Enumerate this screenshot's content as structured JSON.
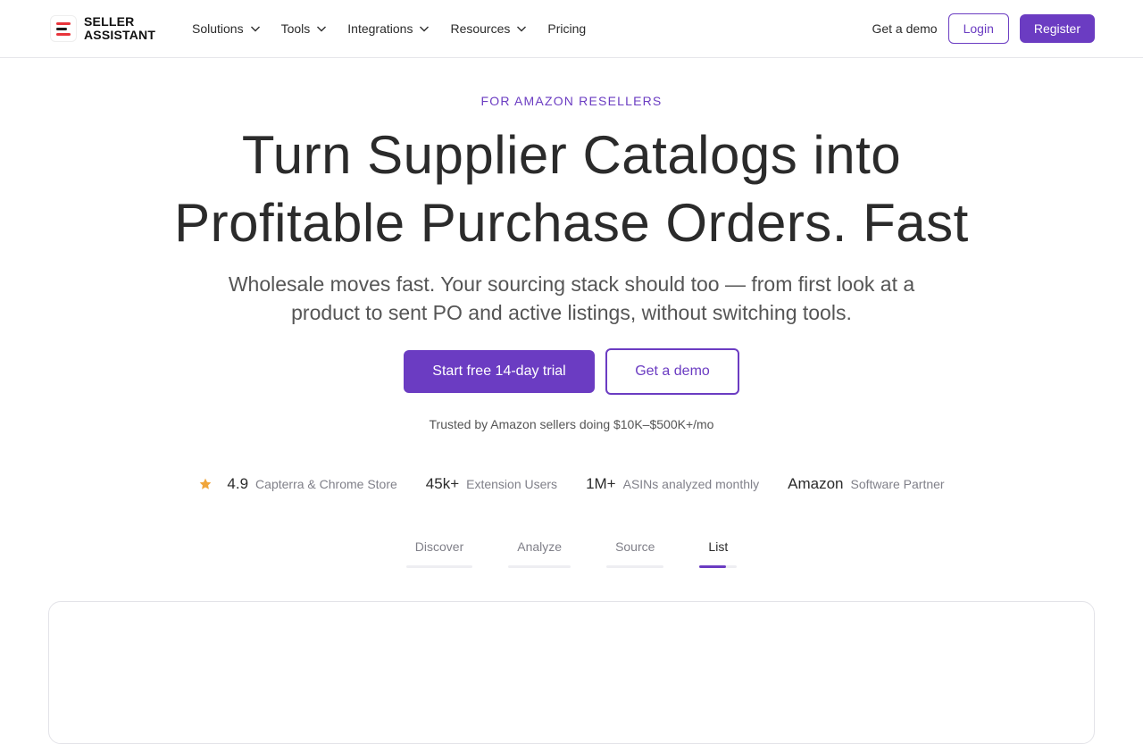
{
  "header": {
    "logo_line1": "SELLER",
    "logo_line2": "ASSISTANT",
    "nav": [
      {
        "label": "Solutions",
        "has_dropdown": true
      },
      {
        "label": "Tools",
        "has_dropdown": true
      },
      {
        "label": "Integrations",
        "has_dropdown": true
      },
      {
        "label": "Resources",
        "has_dropdown": true
      },
      {
        "label": "Pricing",
        "has_dropdown": false
      }
    ],
    "get_demo_label": "Get a demo",
    "login_label": "Login",
    "register_label": "Register"
  },
  "hero": {
    "eyebrow": "FOR AMAZON RESELLERS",
    "title_line1": "Turn Supplier Catalogs into",
    "title_line2": "Profitable Purchase Orders. Fast",
    "subtitle": "Wholesale moves fast. Your sourcing stack should too — from first look at a product to sent PO and active listings, without switching tools.",
    "cta_primary": "Start free 14-day trial",
    "cta_secondary": "Get a demo",
    "trusted": "Trusted by Amazon sellers doing $10K–$500K+/mo"
  },
  "stats": [
    {
      "value": "4.9",
      "label": "Capterra & Chrome Store",
      "icon": "star-icon"
    },
    {
      "value": "45k+",
      "label": "Extension Users"
    },
    {
      "value": "1M+",
      "label": "ASINs analyzed monthly"
    },
    {
      "value": "Amazon",
      "label": "Software Partner"
    }
  ],
  "tabs": [
    {
      "label": "Discover",
      "active": false
    },
    {
      "label": "Analyze",
      "active": false
    },
    {
      "label": "Source",
      "active": false
    },
    {
      "label": "List",
      "active": true
    }
  ],
  "colors": {
    "accent": "#6b3cc2",
    "logo_red": "#e8333a",
    "star": "#f0a53a"
  }
}
